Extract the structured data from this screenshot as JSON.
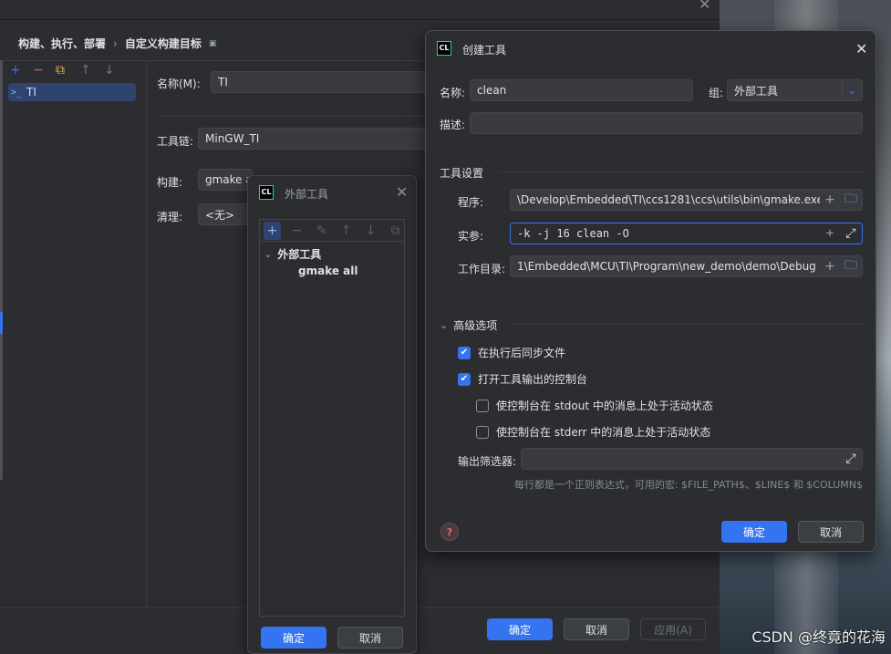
{
  "background": {
    "watermark": "CSDN @终竟的花海"
  },
  "settings": {
    "close_glyph": "✕",
    "breadcrumb": [
      "构建、执行、部署",
      "自定义构建目标"
    ],
    "breadcrumb_sep": "›",
    "breadcrumb_icon": "▣",
    "tree_toolbar": [
      "+",
      "−",
      "⧉",
      "↑",
      "↓"
    ],
    "tree_item": {
      "icon": ">_",
      "label": "TI"
    },
    "name_label": "名称(M):",
    "name_value": "TI",
    "toolchain_label": "工具链:",
    "toolchain_value": "MinGW_TI",
    "build_label": "构建:",
    "build_value": "gmake a",
    "clean_label": "清理:",
    "clean_value": "<无>",
    "ok": "确定",
    "cancel": "取消",
    "apply": "应用(A)"
  },
  "ext_tools": {
    "logo": "CL",
    "title": "外部工具",
    "close_glyph": "✕",
    "toolbar": [
      "+",
      "−",
      "✎",
      "↑",
      "↓",
      "⧉"
    ],
    "group_chevron": "⌄",
    "group": "外部工具",
    "item": "gmake all",
    "ok": "确定",
    "cancel": "取消"
  },
  "create_tool": {
    "logo": "CL",
    "title": "创建工具",
    "close_glyph": "✕",
    "name_label": "名称:",
    "name_value": "clean",
    "group_label": "组:",
    "group_value": "外部工具",
    "group_chevron": "⌄",
    "desc_label": "描述:",
    "desc_value": "",
    "tool_settings": "工具设置",
    "program_label": "程序:",
    "program_value": "\\Develop\\Embedded\\TI\\ccs1281\\ccs\\utils\\bin\\gmake.exe",
    "args_label": "实参:",
    "args_value": "-k -j 16 clean -O",
    "workdir_label": "工作目录:",
    "workdir_value": "1\\Embedded\\MCU\\TI\\Program\\new_demo\\demo\\Debug",
    "plus_glyph": "+",
    "folder_glyph": "🗀",
    "expand_glyph": "⤢",
    "advanced_chevron": "⌄",
    "advanced": "高级选项",
    "check_on": "✔",
    "opt_sync": {
      "label": "在执行后同步文件",
      "checked": true
    },
    "opt_console": {
      "label": "打开工具输出的控制台",
      "checked": true
    },
    "opt_stdout": {
      "label": "使控制台在 stdout 中的消息上处于活动状态",
      "checked": false
    },
    "opt_stderr": {
      "label": "使控制台在 stderr 中的消息上处于活动状态",
      "checked": false
    },
    "filter_label": "输出筛选器:",
    "filter_value": "",
    "filter_hint": "每行都是一个正则表达式，可用的宏: $FILE_PATH$、$LINE$ 和 $COLUMN$",
    "help_glyph": "?",
    "ok": "确定",
    "cancel": "取消"
  },
  "colors": {
    "accent": "#3574f0",
    "bg": "#2b2d30",
    "field": "#393b40"
  }
}
